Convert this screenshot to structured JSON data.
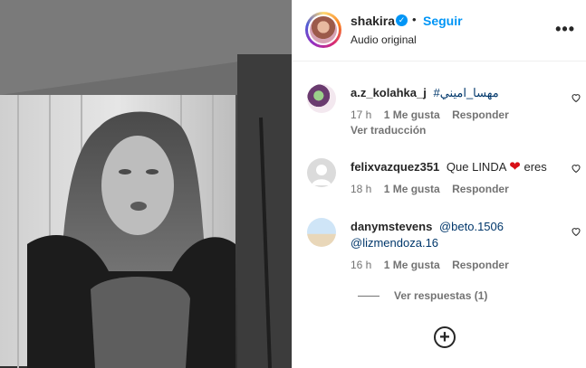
{
  "header": {
    "username": "shakira",
    "follow_label": "Seguir",
    "dot": "•",
    "audio": "Audio original",
    "more": "•••",
    "verified_icon": "verified-badge-icon"
  },
  "comments": [
    {
      "username": "a.z_kolahka_j",
      "text": "#مهسا_اميني",
      "time": "17 h",
      "likes": "1 Me gusta",
      "reply": "Responder",
      "translate": "Ver traducción"
    },
    {
      "username": "felixvazquez351",
      "text": "Que LINDA",
      "emoji": "❤",
      "text_after": "eres",
      "time": "18 h",
      "likes": "1 Me gusta",
      "reply": "Responder"
    },
    {
      "username": "danymstevens",
      "mention1": "@beto.1506",
      "mention2": "@lizmendoza.16",
      "time": "16 h",
      "likes": "1 Me gusta",
      "reply": "Responder"
    }
  ],
  "view_replies": "Ver respuestas (1)",
  "colors": {
    "link": "#0095f6",
    "mention": "#00376b",
    "muted": "#737373",
    "heart": "#d80f16"
  }
}
